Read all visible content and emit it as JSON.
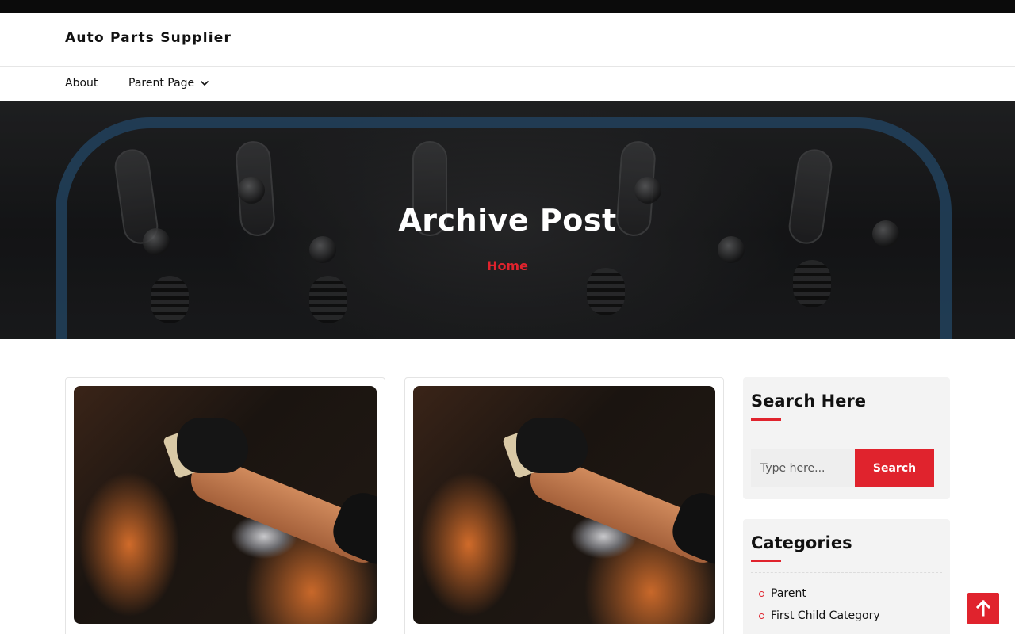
{
  "site": {
    "title": "Auto Parts Supplier"
  },
  "nav": {
    "items": [
      {
        "label": "About"
      },
      {
        "label": "Parent Page",
        "has_dropdown": true,
        "icon": "chevron-down-icon"
      }
    ]
  },
  "hero": {
    "title": "Archive Post",
    "breadcrumb": "Home"
  },
  "posts": [
    {
      "image": "car-detailing-photo"
    },
    {
      "image": "car-detailing-photo"
    }
  ],
  "sidebar": {
    "search": {
      "title": "Search Here",
      "placeholder": "Type here...",
      "button_label": "Search"
    },
    "categories": {
      "title": "Categories",
      "items": [
        "Parent",
        "First Child Category"
      ]
    }
  },
  "scroll_top": {
    "icon": "arrow-up-icon"
  },
  "colors": {
    "accent": "#e0232d",
    "topbar": "#0b0b0b",
    "widget_bg": "#f3f3f3"
  }
}
